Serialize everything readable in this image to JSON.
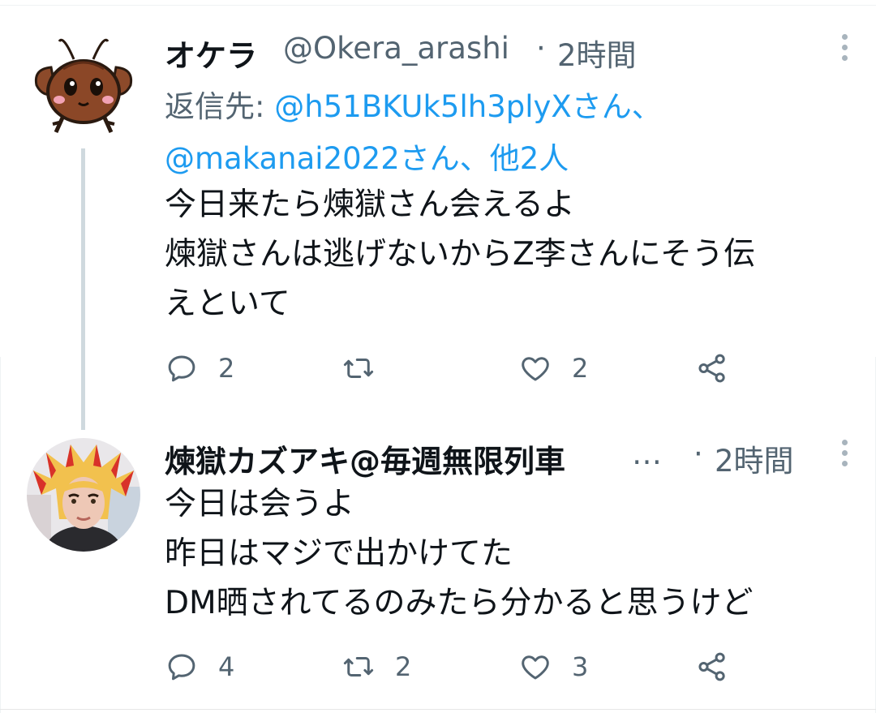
{
  "tweets": [
    {
      "display_name": "オケラ",
      "handle": "@Okera_arashi",
      "separator": "·",
      "time": "2時間",
      "reply_label": "返信先:",
      "reply_mentions": "@h51BKUk5lh3plyXさん、",
      "reply_mentions_2": "@makanai2022さん、他2人",
      "text_lines": [
        "今日来たら煉獄さん会えるよ",
        "煉獄さんは逃げないからZ李さんにそう伝",
        "えといて"
      ],
      "replies": "2",
      "retweets": "",
      "likes": "2",
      "avatar_icon": "cockroach-cartoon-icon"
    },
    {
      "display_name": "煉獄カズアキ@毎週無限列車",
      "handle": "…",
      "separator": "·",
      "time": "2時間",
      "text_lines": [
        "今日は会うよ",
        "昨日はマジで出かけてた",
        "DM晒されてるのみたら分かると思うけど"
      ],
      "replies": "4",
      "retweets": "2",
      "likes": "3",
      "avatar_icon": "cosplay-photo-avatar"
    }
  ],
  "colors": {
    "text": "#0f1419",
    "secondary": "#536471",
    "link": "#1d9bf0",
    "thread_line": "#cfd9de"
  }
}
